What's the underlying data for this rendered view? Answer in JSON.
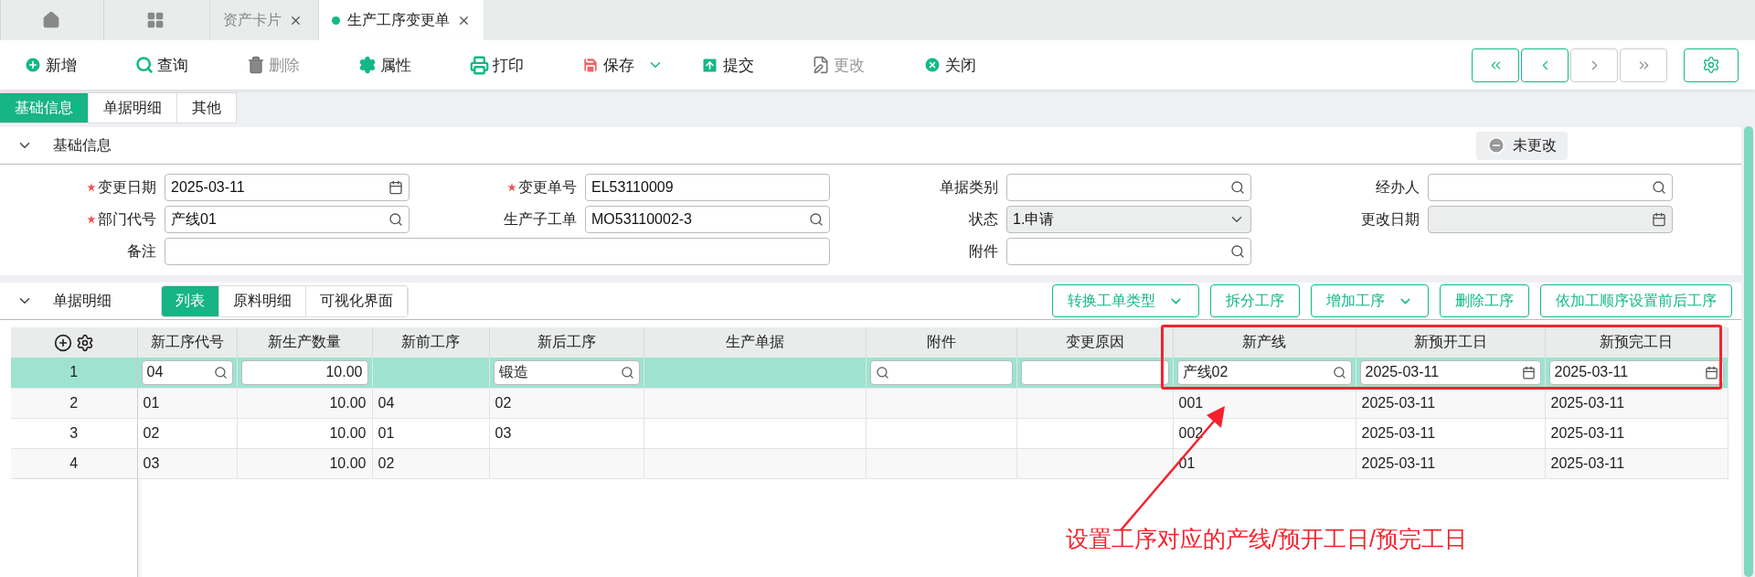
{
  "window_tabs": [
    {
      "kind": "home",
      "selected": false
    },
    {
      "kind": "apps",
      "selected": false
    },
    {
      "kind": "page",
      "label": "资产卡片",
      "selected": false
    },
    {
      "kind": "page",
      "label": "生产工序变更单",
      "selected": true
    }
  ],
  "toolbar": [
    {
      "kind": "add",
      "label": "新增",
      "disabled": false
    },
    {
      "kind": "search",
      "label": "查询",
      "disabled": false
    },
    {
      "kind": "delete",
      "label": "删除",
      "disabled": true
    },
    {
      "kind": "gear",
      "label": "属性",
      "disabled": false
    },
    {
      "kind": "print",
      "label": "打印",
      "disabled": false
    },
    {
      "kind": "save",
      "label": "保存",
      "disabled": false,
      "dropdown": true
    },
    {
      "kind": "submit",
      "label": "提交",
      "disabled": false
    },
    {
      "kind": "edit",
      "label": "更改",
      "disabled": true
    },
    {
      "kind": "close",
      "label": "关闭",
      "disabled": false
    }
  ],
  "record_nav": [
    {
      "kind": "first",
      "disabled": false
    },
    {
      "kind": "prev",
      "disabled": false
    },
    {
      "kind": "next",
      "disabled": true
    },
    {
      "kind": "last",
      "disabled": true
    }
  ],
  "section_tabs": [
    {
      "label": "基础信息",
      "selected": true
    },
    {
      "label": "单据明细",
      "selected": false
    },
    {
      "label": "其他",
      "selected": false
    }
  ],
  "basic_info": {
    "title": "基础信息",
    "expanded": true,
    "status": "未更改",
    "fields": [
      {
        "label": "变更日期",
        "required": true,
        "kind": "date",
        "disabled": false,
        "value": "2025-03-11"
      },
      {
        "label": "变更单号",
        "required": true,
        "kind": "text",
        "disabled": false,
        "value": "EL53110009"
      },
      {
        "label": "单据类别",
        "required": false,
        "kind": "lookup",
        "disabled": false
      },
      {
        "label": "经办人",
        "required": false,
        "kind": "lookup",
        "disabled": false
      },
      {
        "label": "部门代号",
        "required": true,
        "kind": "lookup",
        "disabled": false,
        "value": "产线01"
      },
      {
        "label": "生产子工单",
        "required": false,
        "kind": "lookup",
        "disabled": false,
        "value": "MO53110002-3"
      },
      {
        "label": "状态",
        "required": false,
        "kind": "select",
        "disabled": false,
        "value": "1.申请"
      },
      {
        "label": "更改日期",
        "required": false,
        "kind": "date",
        "disabled": true
      },
      {
        "label": "备注",
        "required": false,
        "kind": "text",
        "disabled": false,
        "wide": true
      },
      {
        "label": "附件",
        "required": false,
        "kind": "lookup",
        "disabled": false
      }
    ]
  },
  "detail": {
    "title": "单据明细",
    "expanded": true,
    "tabs": [
      {
        "label": "列表",
        "selected": true
      },
      {
        "label": "原料明细",
        "selected": false
      },
      {
        "label": "可视化界面",
        "selected": false
      }
    ],
    "actions": [
      {
        "label": "转换工单类型",
        "dropdown": true
      },
      {
        "label": "拆分工序",
        "dropdown": false
      },
      {
        "label": "增加工序",
        "dropdown": true
      },
      {
        "label": "删除工序",
        "dropdown": false
      },
      {
        "label": "依加工顺序设置前后工序",
        "dropdown": false
      }
    ],
    "table": {
      "columns": [
        {
          "title": "新工序代号",
          "kind": "lookup"
        },
        {
          "title": "新生产数量",
          "kind": "number"
        },
        {
          "title": "新前工序",
          "kind": "plain"
        },
        {
          "title": "新后工序",
          "kind": "lookup"
        },
        {
          "title": "生产单据",
          "kind": "plain"
        },
        {
          "title": "附件",
          "kind": "lookup"
        },
        {
          "title": "变更原因",
          "kind": "text"
        },
        {
          "title": "新产线",
          "kind": "lookup"
        },
        {
          "title": "新预开工日",
          "kind": "date"
        },
        {
          "title": "新预完工日",
          "kind": "date"
        }
      ],
      "rows": [
        {
          "number": "1",
          "selected": true,
          "cells": [
            "04",
            "10.00",
            null,
            "锻造",
            null,
            null,
            null,
            "产线02",
            "2025-03-11",
            "2025-03-11"
          ]
        },
        {
          "number": "2",
          "selected": false,
          "cells": [
            "01",
            "10.00",
            "04",
            "02",
            null,
            null,
            null,
            "001",
            "2025-03-11",
            "2025-03-11"
          ]
        },
        {
          "number": "3",
          "selected": false,
          "cells": [
            "02",
            "10.00",
            "01",
            "03",
            null,
            null,
            null,
            "002",
            "2025-03-11",
            "2025-03-11"
          ]
        },
        {
          "number": "4",
          "selected": false,
          "cells": [
            "03",
            "10.00",
            "02",
            null,
            null,
            null,
            null,
            "01",
            "2025-03-11",
            "2025-03-11"
          ]
        }
      ]
    }
  },
  "annotation": {
    "text": "设置工序对应的产线/预开工日/预完工日"
  }
}
